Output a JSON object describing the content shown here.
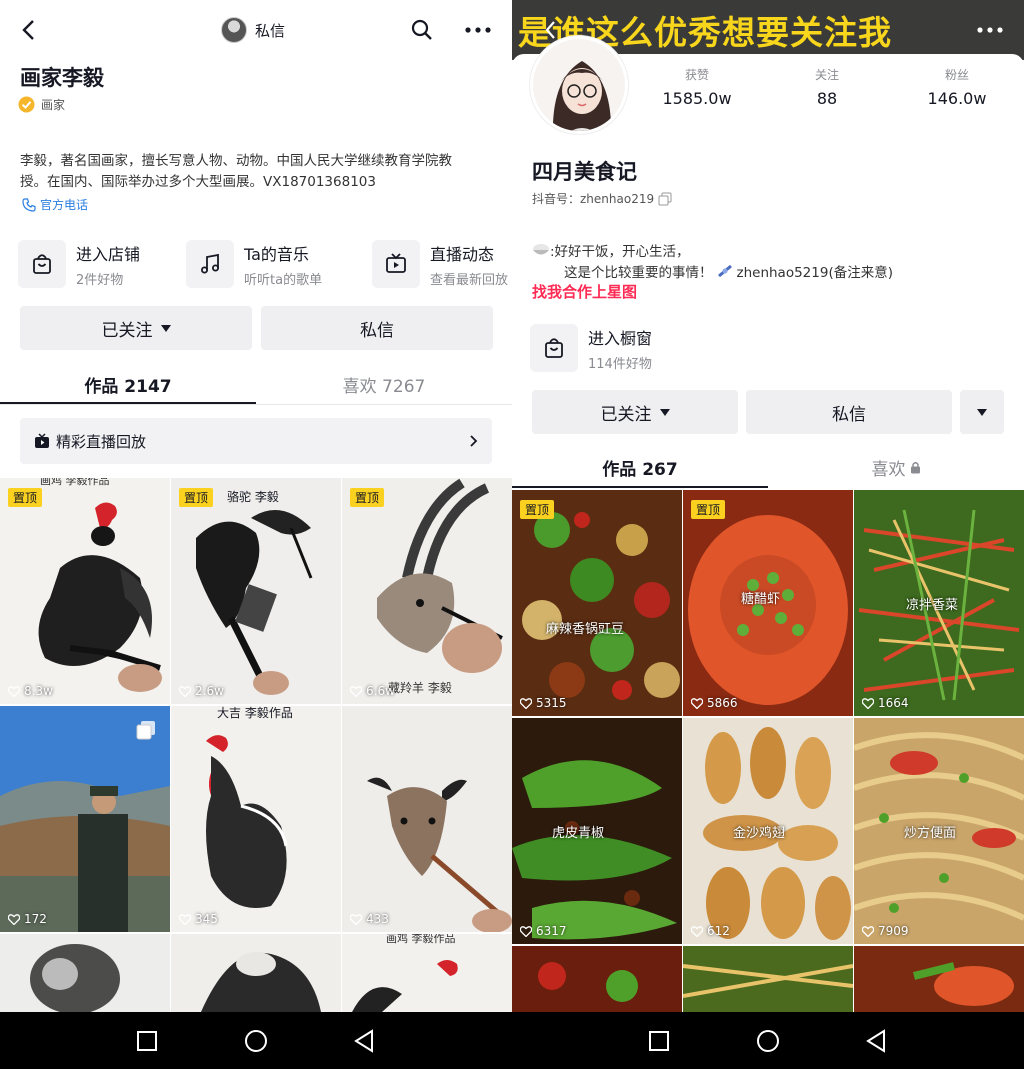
{
  "left": {
    "nav": {
      "message_label": "私信"
    },
    "profile": {
      "name": "画家李毅",
      "verified_label": "画家",
      "bio_line1": "李毅，著名国画家，擅长写意人物、动物。中国人民大学继续教育学院教",
      "bio_line2": "授。在国内、国际举办过多个大型画展。VX18701368103",
      "phone_link": "官方电话"
    },
    "quick": [
      {
        "title": "进入店铺",
        "sub": "2件好物",
        "icon": "shopping-bag-icon"
      },
      {
        "title": "Ta的音乐",
        "sub": "听听ta的歌单",
        "icon": "music-note-icon"
      },
      {
        "title": "直播动态",
        "sub": "查看最新回放",
        "icon": "live-tv-icon"
      }
    ],
    "buttons": {
      "followed": "已关注",
      "message": "私信"
    },
    "tabs": {
      "works": "作品 2147",
      "likes": "喜欢 7267"
    },
    "live_banner": "精彩直播回放",
    "grid": [
      {
        "likes": "8.3w",
        "pinned": "置顶",
        "top_caption": "画鸡 李毅作品"
      },
      {
        "likes": "2.6w",
        "pinned": "置顶",
        "top_caption": "骆驼  李毅"
      },
      {
        "likes": "6.6w",
        "pinned": "置顶",
        "bottom_caption": "藏羚羊  李毅"
      },
      {
        "likes": "172"
      },
      {
        "likes": "345",
        "top_caption": "大吉  李毅作品"
      },
      {
        "likes": "433"
      },
      {
        "likes": ""
      },
      {
        "likes": ""
      },
      {
        "likes": "",
        "top_caption": "画鸡 李毅作品"
      }
    ]
  },
  "right": {
    "banner_text": "是谁这么优秀想要关注我",
    "stats": [
      {
        "label": "获赞",
        "value": "1585.0w"
      },
      {
        "label": "关注",
        "value": "88"
      },
      {
        "label": "粉丝",
        "value": "146.0w"
      }
    ],
    "profile": {
      "name": "四月美食记",
      "id_label": "抖音号：zhenhao219",
      "bio_line1": ":好好干饭，开心生活，",
      "bio_line2": "这是个比较重要的事情！",
      "bio_contact": "zhenhao5219(备注来意)",
      "link": "找我合作上星图"
    },
    "window": {
      "title": "进入橱窗",
      "sub": "114件好物"
    },
    "buttons": {
      "followed": "已关注",
      "message": "私信"
    },
    "tabs": {
      "works": "作品 267",
      "likes": "喜欢"
    },
    "grid": [
      {
        "likes": "5315",
        "pinned": "置顶",
        "caption": "麻辣香锅豇豆"
      },
      {
        "likes": "5866",
        "pinned": "置顶",
        "caption": "糖醋虾"
      },
      {
        "likes": "1664",
        "caption": "凉拌香菜"
      },
      {
        "likes": "6317",
        "caption": "虎皮青椒"
      },
      {
        "likes": "612",
        "caption": "金沙鸡翅"
      },
      {
        "likes": "7909",
        "caption": "炒方便面"
      },
      {
        "likes": ""
      },
      {
        "likes": ""
      },
      {
        "likes": ""
      }
    ]
  },
  "colors": {
    "accent_pink": "#fe2c55",
    "pin_yellow": "#fbd11f",
    "link_blue": "#2a7ee0"
  }
}
